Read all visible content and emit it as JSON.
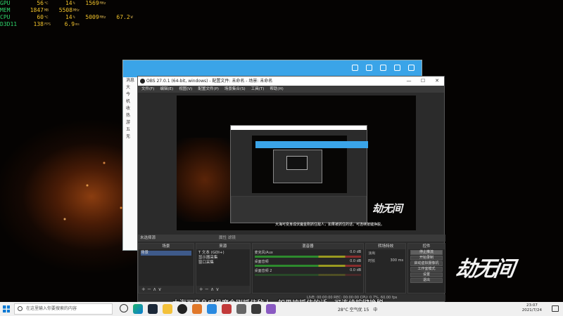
{
  "hw": [
    {
      "name": "GPU",
      "v1": "56",
      "u1": "℃",
      "v2": "14",
      "u2": "%",
      "v3": "1569",
      "u3": "MHz",
      "v4": "",
      "u4": ""
    },
    {
      "name": "MEM",
      "v1": "1847",
      "u1": "MB",
      "v2": "5508",
      "u2": "MHz",
      "v3": "",
      "u3": "",
      "v4": "",
      "u4": ""
    },
    {
      "name": "CPU",
      "v1": "60",
      "u1": "℃",
      "v2": "14",
      "u2": "%",
      "v3": "5009",
      "u3": "MHz",
      "v4": "67.2",
      "u4": "W"
    },
    {
      "name": "D3D11",
      "v1": "138",
      "u1": "FPS",
      "v2": "6.9",
      "u2": "ms",
      "v3": "",
      "u3": "",
      "v4": "",
      "u4": ""
    }
  ],
  "chat": {
    "list": [
      "消息",
      "大",
      "今",
      "机",
      "收",
      "热",
      "游",
      "五",
      "无"
    ]
  },
  "obs": {
    "title": "OBS 27.0.1 (64-bit, windows) - 配置文件: 未命名 - 场景: 未命名",
    "win_min": "—",
    "win_max": "☐",
    "win_close": "✕",
    "menu": [
      "文件(F)",
      "编辑(E)",
      "视图(V)",
      "配置文件(P)",
      "场景集合(S)",
      "工具(T)",
      "帮助(H)"
    ],
    "no_source": "未选择源",
    "studio": "属性   滤镜",
    "scenes_title": "场景",
    "scenes": [
      "场景"
    ],
    "sources_title": "来源",
    "sources": [
      "T 文本 (GDI+)",
      "显示器采集",
      "窗口采集"
    ],
    "mixer_title": "混音器",
    "mixer": [
      {
        "name": "麦克风/Aux",
        "db": "0.0 dB",
        "level": 0.6
      },
      {
        "name": "桌面音频",
        "db": "0.0 dB",
        "level": 0.55
      },
      {
        "name": "桌面音频 2",
        "db": "0.0 dB",
        "level": 0.0
      }
    ],
    "trans_title": "转场特效",
    "trans_type": "淡出",
    "trans_dur_label": "时长",
    "trans_dur": "300 ms",
    "ctrl_title": "控件",
    "controls": [
      "停止推流",
      "开始录制",
      "启动虚拟摄像机",
      "工作室模式",
      "设置",
      "退出"
    ],
    "footer_btns": "+ − ∧ ∨",
    "status": "LIVE: 00:00:00   REC: 00:00:00   CPU: 0.7%, 60.00 fps",
    "preview_caption": "大海可变身成伏魔金刚抓住敌人，如果被抓住的话，可连续按键挣脱。"
  },
  "calligraphy": "劫无间",
  "subtitle": "大海可变身成伏魔金刚抓住敌人，如果被抓住的话，可连续按键挣脱。",
  "taskbar": {
    "search_placeholder": "在这里输入你要搜索的内容",
    "weather": "28°C  空气优 15",
    "ime": "中",
    "time": "23:07",
    "date": "2021/7/24"
  }
}
